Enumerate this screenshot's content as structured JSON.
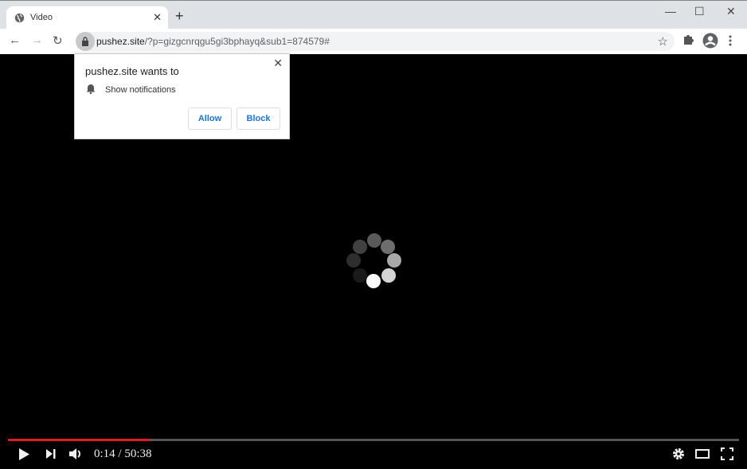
{
  "browser": {
    "tab": {
      "title": "Video",
      "icon": "globe-icon"
    },
    "new_tab_icon": "+",
    "window_controls": {
      "minimize": "—",
      "maximize": "☐",
      "close": "✕"
    },
    "nav": {
      "back": "←",
      "forward": "→",
      "reload": "↻"
    },
    "url": {
      "domain": "pushez.site",
      "path": "/?p=gizgcnrqgu5gi3bphayq&sub1=874579#"
    },
    "bookmark_icon": "☆"
  },
  "permission_popup": {
    "heading": "pushez.site wants to",
    "permission": "Show notifications",
    "allow_label": "Allow",
    "block_label": "Block",
    "close_icon": "✕"
  },
  "player": {
    "current_time": "0:14",
    "duration": "50:38",
    "time_display": "0:14 / 50:38",
    "progress_fill_fraction": 0.194,
    "accent_color": "#e21c1c"
  }
}
